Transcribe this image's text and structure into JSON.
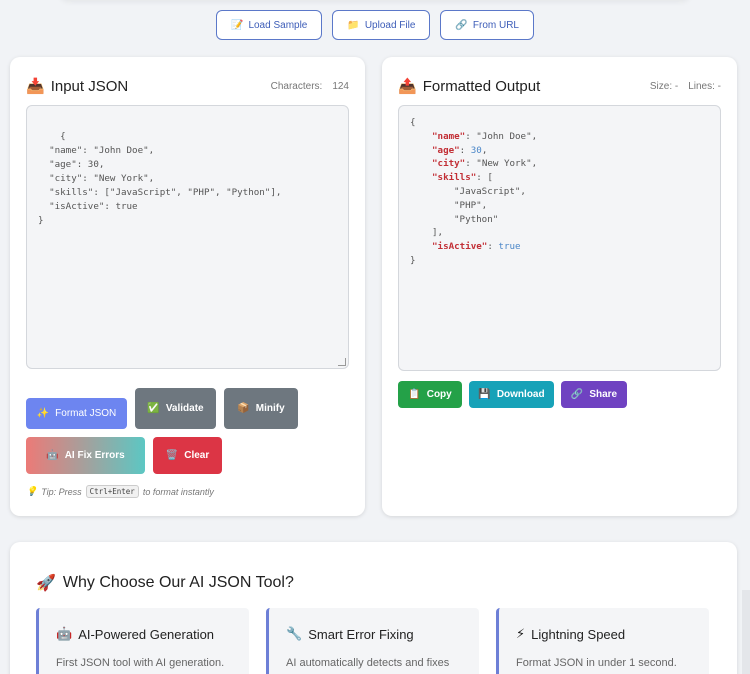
{
  "source_buttons": [
    {
      "icon": "📝",
      "label": "Load Sample"
    },
    {
      "icon": "📁",
      "label": "Upload File"
    },
    {
      "icon": "🔗",
      "label": "From URL"
    }
  ],
  "input_panel": {
    "title": "Input JSON",
    "icon": "📥",
    "characters_label": "Characters:",
    "characters_value": "124",
    "content": "{\n  \"name\": \"John Doe\",\n  \"age\": 30,\n  \"city\": \"New York\",\n  \"skills\": [\"JavaScript\", \"PHP\", \"Python\"],\n  \"isActive\": true\n}",
    "buttons": {
      "format": {
        "icon": "✨",
        "label": "Format JSON"
      },
      "validate": {
        "icon": "✅",
        "label": "Validate"
      },
      "minify": {
        "icon": "📦",
        "label": "Minify"
      },
      "ai_fix": {
        "icon": "🤖",
        "label": "AI Fix Errors"
      },
      "clear": {
        "icon": "🗑️",
        "label": "Clear"
      }
    },
    "tip": {
      "icon": "💡",
      "prefix": "Tip: Press",
      "key": "Ctrl+Enter",
      "suffix": "to format instantly"
    }
  },
  "output_panel": {
    "title": "Formatted Output",
    "icon": "📤",
    "size_label": "Size: -",
    "lines_label": "Lines: -",
    "content_lines": [
      {
        "indent": 0,
        "parts": [
          {
            "t": "p",
            "v": "{"
          }
        ]
      },
      {
        "indent": 1,
        "parts": [
          {
            "t": "k",
            "v": "\"name\""
          },
          {
            "t": "p",
            "v": ": "
          },
          {
            "t": "s",
            "v": "\"John Doe\""
          },
          {
            "t": "p",
            "v": ","
          }
        ]
      },
      {
        "indent": 1,
        "parts": [
          {
            "t": "k",
            "v": "\"age\""
          },
          {
            "t": "p",
            "v": ": "
          },
          {
            "t": "n",
            "v": "30"
          },
          {
            "t": "p",
            "v": ","
          }
        ]
      },
      {
        "indent": 1,
        "parts": [
          {
            "t": "k",
            "v": "\"city\""
          },
          {
            "t": "p",
            "v": ": "
          },
          {
            "t": "s",
            "v": "\"New York\""
          },
          {
            "t": "p",
            "v": ","
          }
        ]
      },
      {
        "indent": 1,
        "parts": [
          {
            "t": "k",
            "v": "\"skills\""
          },
          {
            "t": "p",
            "v": ": ["
          }
        ]
      },
      {
        "indent": 2,
        "parts": [
          {
            "t": "s",
            "v": "\"JavaScript\""
          },
          {
            "t": "p",
            "v": ","
          }
        ]
      },
      {
        "indent": 2,
        "parts": [
          {
            "t": "s",
            "v": "\"PHP\""
          },
          {
            "t": "p",
            "v": ","
          }
        ]
      },
      {
        "indent": 2,
        "parts": [
          {
            "t": "s",
            "v": "\"Python\""
          }
        ]
      },
      {
        "indent": 1,
        "parts": [
          {
            "t": "p",
            "v": "],"
          }
        ]
      },
      {
        "indent": 1,
        "parts": [
          {
            "t": "k",
            "v": "\"isActive\""
          },
          {
            "t": "p",
            "v": ": "
          },
          {
            "t": "b",
            "v": "true"
          }
        ]
      },
      {
        "indent": 0,
        "parts": [
          {
            "t": "p",
            "v": "}"
          }
        ]
      }
    ],
    "buttons": {
      "copy": {
        "icon": "📋",
        "label": "Copy"
      },
      "download": {
        "icon": "💾",
        "label": "Download"
      },
      "share": {
        "icon": "🔗",
        "label": "Share"
      }
    }
  },
  "features": {
    "icon": "🚀",
    "title": "Why Choose Our AI JSON Tool?",
    "cards": [
      {
        "icon": "🤖",
        "title": "AI-Powered Generation",
        "desc": "First JSON tool with AI generation."
      },
      {
        "icon": "🔧",
        "title": "Smart Error Fixing",
        "desc": "AI automatically detects and fixes"
      },
      {
        "icon": "⚡",
        "title": "Lightning Speed",
        "desc": "Format JSON in under 1 second."
      }
    ]
  },
  "colors": {
    "accent": "#6d85f0",
    "validate": "#6e777f",
    "clear": "#dc3545",
    "copy": "#24a148",
    "download": "#17a2b8",
    "share": "#6f42c1",
    "json_key": "#c22f36",
    "json_number": "#4a86c8"
  }
}
